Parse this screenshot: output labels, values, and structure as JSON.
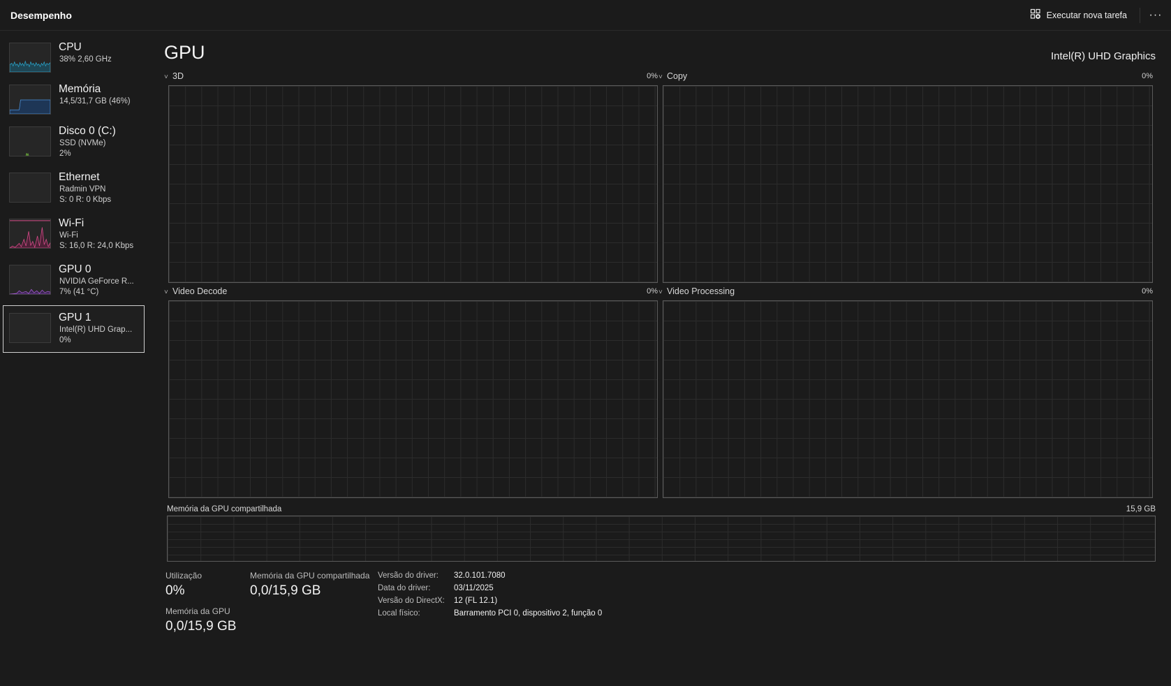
{
  "app": {
    "title": "Desempenho",
    "run_task_label": "Executar nova tarefa",
    "more_label": "···"
  },
  "sidebar": {
    "items": [
      {
        "name": "CPU",
        "sub1": "38% 2,60 GHz",
        "sub2": "",
        "color": "#29a3c9"
      },
      {
        "name": "Memória",
        "sub1": "14,5/31,7 GB (46%)",
        "sub2": "",
        "color": "#4a90d9"
      },
      {
        "name": "Disco 0 (C:)",
        "sub1": "SSD (NVMe)",
        "sub2": "2%",
        "color": "#6fb33b"
      },
      {
        "name": "Ethernet",
        "sub1": "Radmin VPN",
        "sub2": "S: 0 R: 0 Kbps",
        "color": "#a35ba3"
      },
      {
        "name": "Wi-Fi",
        "sub1": "Wi-Fi",
        "sub2": "S: 16,0 R: 24,0 Kbps",
        "color": "#d64c8a"
      },
      {
        "name": "GPU 0",
        "sub1": "NVIDIA GeForce R...",
        "sub2": "7% (41 °C)",
        "color": "#a45bd1"
      },
      {
        "name": "GPU 1",
        "sub1": "Intel(R) UHD Grap...",
        "sub2": "0%",
        "color": "#a45bd1"
      }
    ],
    "selected_index": 6
  },
  "main": {
    "title": "GPU",
    "device": "Intel(R) UHD Graphics",
    "graphs": [
      {
        "label": "3D",
        "pct": "0%"
      },
      {
        "label": "Copy",
        "pct": "0%"
      },
      {
        "label": "Video Decode",
        "pct": "0%"
      },
      {
        "label": "Video Processing",
        "pct": "0%"
      }
    ],
    "shared_memory": {
      "label": "Memória da GPU compartilhada",
      "max": "15,9 GB"
    },
    "stats": {
      "utilization_label": "Utilização",
      "utilization_value": "0%",
      "shared_label": "Memória da GPU compartilhada",
      "shared_value": "0,0/15,9 GB",
      "gpu_mem_label": "Memória da GPU",
      "gpu_mem_value": "0,0/15,9 GB"
    },
    "info": [
      {
        "key": "Versão do driver:",
        "value": "32.0.101.7080"
      },
      {
        "key": "Data do driver:",
        "value": "03/11/2025"
      },
      {
        "key": "Versão do DirectX:",
        "value": "12 (FL 12.1)"
      },
      {
        "key": "Local físico:",
        "value": "Barramento PCI 0, dispositivo 2, função 0"
      }
    ]
  }
}
